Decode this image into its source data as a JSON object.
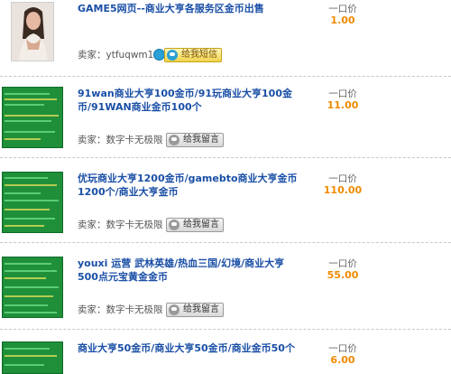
{
  "listings": [
    {
      "title": "GAME5网页--商业大亨各服务区金币出售",
      "seller_prefix": "卖家：",
      "seller_name": "ytfuqwm1",
      "message_button": "给我短信",
      "price_label": "一口价",
      "price": "1.00",
      "thumbnail": "photo-of-woman"
    },
    {
      "title": "91wan商业大亨100金币/91玩商业大亨100金币/91WAN商业金币100个",
      "seller_prefix": "卖家：",
      "seller_name": "数字卡无极限",
      "message_button": "给我留言",
      "price_label": "一口价",
      "price": "11.00",
      "thumbnail": "green-text-banner"
    },
    {
      "title": "优玩商业大亨1200金币/gamebto商业大亨金币1200个/商业大亨金币",
      "seller_prefix": "卖家：",
      "seller_name": "数字卡无极限",
      "message_button": "给我留言",
      "price_label": "一口价",
      "price": "110.00",
      "thumbnail": "green-text-banner"
    },
    {
      "title": "youxi 运营 武林英雄/热血三国/幻境/商业大亨500点元宝黄金金币",
      "seller_prefix": "卖家：",
      "seller_name": "数字卡无极限",
      "message_button": "给我留言",
      "price_label": "一口价",
      "price": "55.00",
      "thumbnail": "green-text-banner"
    },
    {
      "title": "商业大亨50金币/商业大亨50金币/商业金币50个",
      "price_label": "一口价",
      "price": "6.00",
      "thumbnail": "green-text-banner"
    }
  ],
  "colors": {
    "title": "#1a4fa6",
    "price": "#f08a00",
    "thumb_green": "#1f8f3a"
  }
}
